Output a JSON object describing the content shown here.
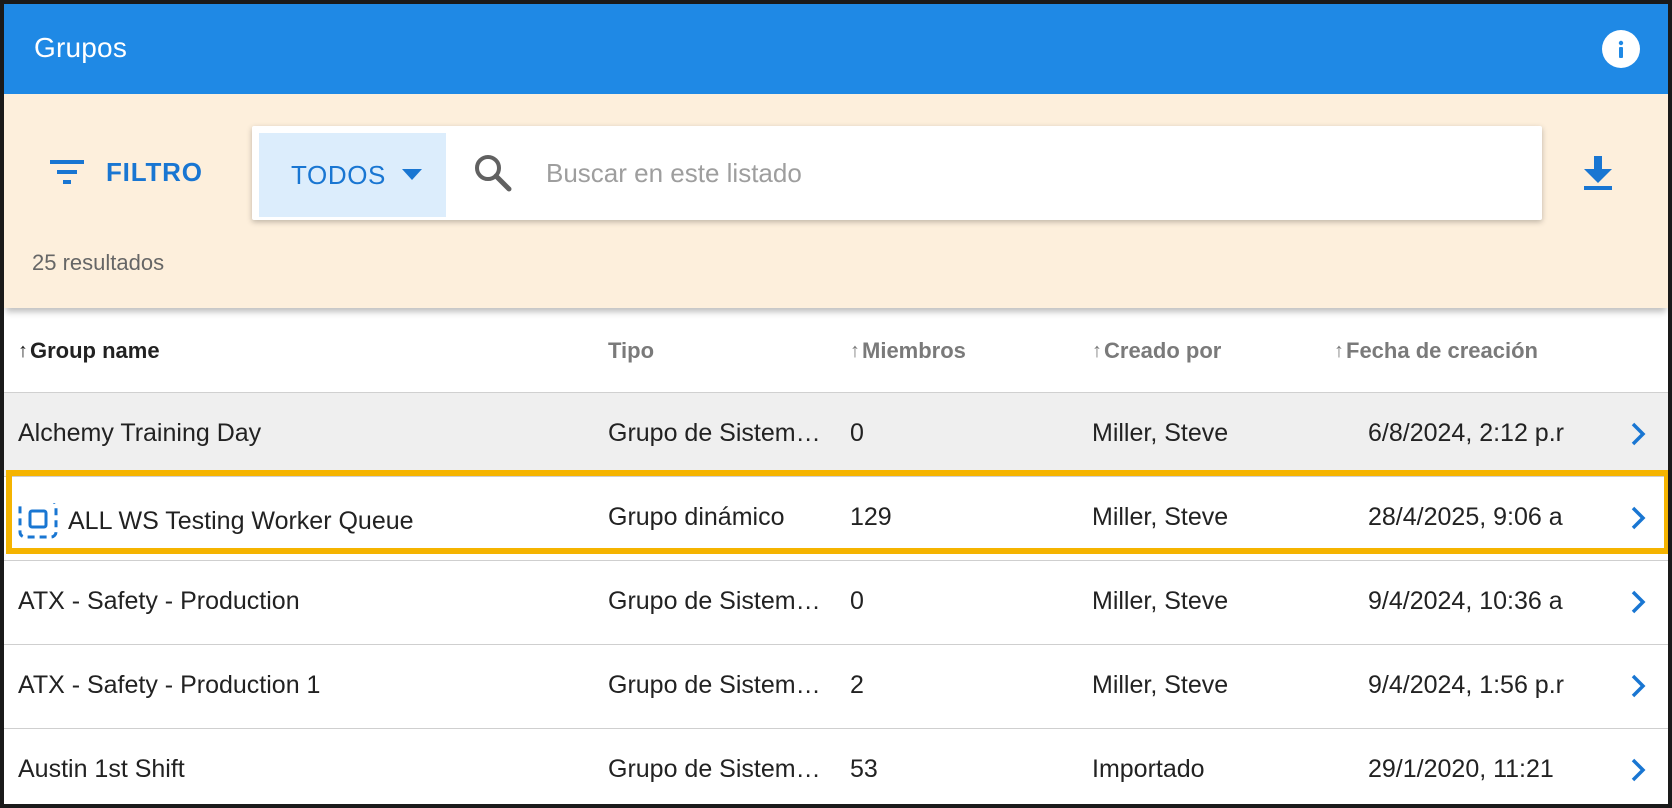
{
  "header": {
    "title": "Grupos",
    "info_icon": "info-icon"
  },
  "toolbar": {
    "filter_label": "FILTRO",
    "scope_value": "TODOS",
    "search_placeholder": "Buscar en este listado",
    "results_text": "25 resultados",
    "download_icon": "download-icon"
  },
  "table": {
    "headers": {
      "name": "Group name",
      "type": "Tipo",
      "members": "Miembros",
      "creator": "Creado por",
      "date": "Fecha de creación"
    },
    "rows": [
      {
        "name": "Alchemy Training Day",
        "type": "Grupo de Sistem…",
        "members": "0",
        "creator": "Miller, Steve",
        "date": "6/8/2024, 2:12 p.r"
      },
      {
        "name": "ALL WS Testing Worker Queue",
        "type": "Grupo dinámico",
        "members": "129",
        "creator": "Miller, Steve",
        "date": "28/4/2025, 9:06 a"
      },
      {
        "name": "ATX - Safety - Production",
        "type": "Grupo de Sistem…",
        "members": "0",
        "creator": "Miller, Steve",
        "date": "9/4/2024, 10:36 a"
      },
      {
        "name": "ATX - Safety - Production 1",
        "type": "Grupo de Sistem…",
        "members": "2",
        "creator": "Miller, Steve",
        "date": "9/4/2024, 1:56 p.r"
      },
      {
        "name": "Austin 1st Shift",
        "type": "Grupo de Sistem…",
        "members": "53",
        "creator": "Importado",
        "date": "29/1/2020, 11:21"
      }
    ]
  },
  "colors": {
    "header_bg": "#1f89e5",
    "toolbar_bg": "#fdefdc",
    "accent": "#1976d2",
    "highlight": "#f5b400"
  }
}
